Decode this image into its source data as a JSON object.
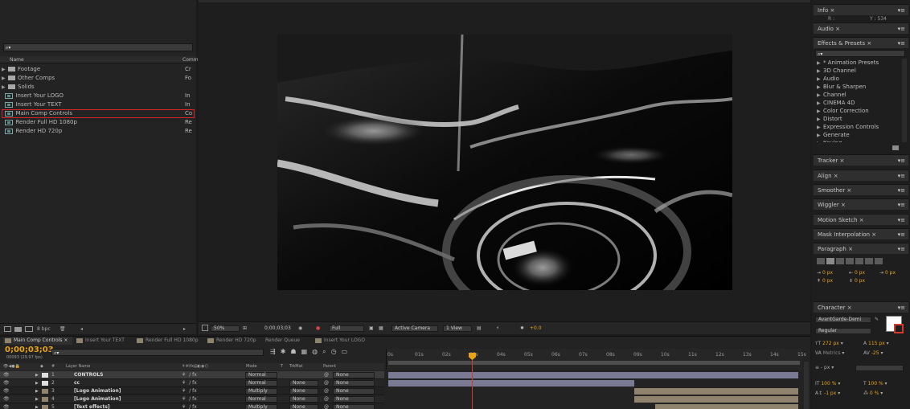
{
  "project": {
    "search_placeholder": "⌕▾",
    "col_name": "Name",
    "col_comment": "Comm",
    "items": [
      {
        "name": "Footage",
        "comment": "Cr",
        "kind": "folder"
      },
      {
        "name": "Other Comps",
        "comment": "Fo",
        "kind": "folder"
      },
      {
        "name": "Solids",
        "comment": "",
        "kind": "folder"
      },
      {
        "name": "Insert Your LOGO",
        "comment": "In",
        "kind": "comp"
      },
      {
        "name": "Insert Your TEXT",
        "comment": "In",
        "kind": "comp"
      },
      {
        "name": "Main Comp Controls",
        "comment": "Co",
        "kind": "comp",
        "selected": true
      },
      {
        "name": "Render Full HD 1080p",
        "comment": "Re",
        "kind": "comp"
      },
      {
        "name": "Render HD 720p",
        "comment": "Re",
        "kind": "comp"
      }
    ],
    "bpc": "8 bpc"
  },
  "viewer_bar": {
    "zoom": "50%",
    "timecode": "0;00;03;03",
    "resolution": "Full",
    "camera": "Active Camera",
    "view": "1 View",
    "exposure": "+0.0"
  },
  "timeline": {
    "tabs": [
      "Main Comp Controls",
      "Insert Your TEXT",
      "Render Full HD 1080p",
      "Render HD 720p",
      "Render Queue",
      "Insert Your LOGO"
    ],
    "timecode": "0;00;03;03",
    "frame_info": "00093 (29.97 fps)",
    "col_layer_name": "Layer Name",
    "col_mode": "Mode",
    "col_t": "T",
    "col_trkmat": "TrkMat",
    "col_parent": "Parent",
    "ticks": [
      "0s",
      "01s",
      "02s",
      "03s",
      "04s",
      "05s",
      "06s",
      "07s",
      "08s",
      "09s",
      "10s",
      "11s",
      "12s",
      "13s",
      "14s",
      "15s"
    ],
    "layers": [
      {
        "num": "1",
        "name": "CONTROLS",
        "mode": "Normal",
        "trkmat": "",
        "parent": "None",
        "selected": true
      },
      {
        "num": "2",
        "name": "cc",
        "mode": "Normal",
        "trkmat": "None",
        "parent": "None"
      },
      {
        "num": "3",
        "name": "[Logo Animation]",
        "mode": "Multiply",
        "trkmat": "None",
        "parent": "None"
      },
      {
        "num": "4",
        "name": "[Logo Animation]",
        "mode": "Normal",
        "trkmat": "None",
        "parent": "None"
      },
      {
        "num": "5",
        "name": "[Text effects]",
        "mode": "Multiply",
        "trkmat": "None",
        "parent": "None"
      }
    ]
  },
  "right_panels": {
    "info": "Info",
    "info_values": [
      "R :",
      "Y : 534"
    ],
    "audio": "Audio",
    "effects_presets": "Effects & Presets",
    "effects_search": "⌕▾",
    "effects": [
      "* Animation Presets",
      "3D Channel",
      "Audio",
      "Blur & Sharpen",
      "Channel",
      "CINEMA 4D",
      "Color Correction",
      "Distort",
      "Expression Controls",
      "Generate",
      "Keying"
    ],
    "tracker": "Tracker",
    "align": "Align",
    "smoother": "Smoother",
    "wiggler": "Wiggler",
    "motion_sketch": "Motion Sketch",
    "mask_interpolation": "Mask Interpolation",
    "paragraph": "Paragraph",
    "para_values": [
      "0 px",
      "0 px",
      "0 px",
      "0 px",
      "0 px"
    ],
    "character": "Character",
    "font": "AvantGarde-Demi",
    "style": "Regular",
    "size": "272 px",
    "leading": "115 px",
    "kerning": "Metrics",
    "tracking": "-25",
    "stroke": "- px",
    "vscale": "100 %",
    "hscale": "100 %",
    "baseline": "-1 px",
    "tsume": "0 %"
  },
  "colors": {
    "accent": "#e8a317",
    "selection_outline": "#d8232a",
    "playhead": "#d23a2a",
    "bar_control": "#7b7a94",
    "bar_logo": "#8f836d"
  }
}
